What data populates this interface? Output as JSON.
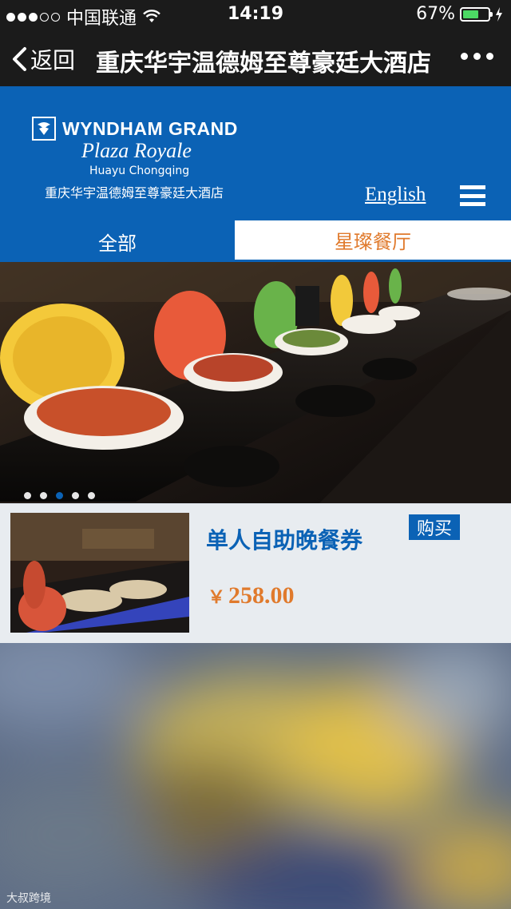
{
  "status_bar": {
    "carrier": "中国联通",
    "time": "14:19",
    "battery": "67%",
    "battery_level": 0.67
  },
  "nav": {
    "back_label": "返回",
    "title": "重庆华宇温德姆至尊豪廷大酒店"
  },
  "header": {
    "logo": {
      "brand": "WYNDHAM GRAND",
      "script": "Plaza Royale",
      "city": "Huayu Chongqing",
      "cn_name": "重庆华宇温德姆至尊豪廷大酒店"
    },
    "language_link": "English"
  },
  "tabs": [
    {
      "label": "全部",
      "active": true
    },
    {
      "label": "星璨餐厅",
      "active": false
    }
  ],
  "carousel": {
    "slide_count": 5,
    "active_index": 2
  },
  "product": {
    "name": "单人自助晚餐券",
    "buy_label": "购买",
    "currency": "￥",
    "price": "258.00"
  },
  "watermark": "大叔跨境",
  "colors": {
    "accent": "#0b62b5",
    "price": "#e07a2c",
    "navbar": "#1b1b1b"
  }
}
